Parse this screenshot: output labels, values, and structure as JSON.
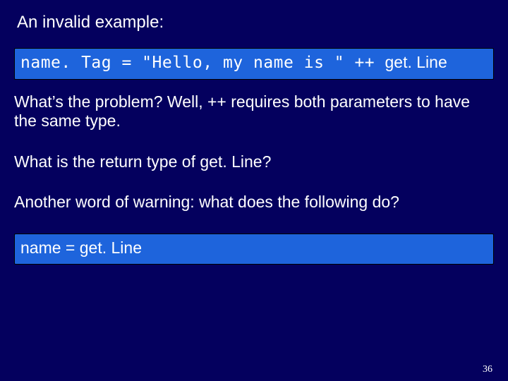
{
  "title": "An invalid example:",
  "code1": {
    "lhs_mono": "name. Tag = \"Hello, my name is \" ++ ",
    "rhs_sans": "get. Line"
  },
  "para1": "What’s the problem?  Well, ++ requires both parameters to have the same type.",
  "para2": "What is the return type of get. Line?",
  "para3": "Another word of warning: what does the following do?",
  "code2": {
    "text": "name = get. Line"
  },
  "pageNumber": "36"
}
